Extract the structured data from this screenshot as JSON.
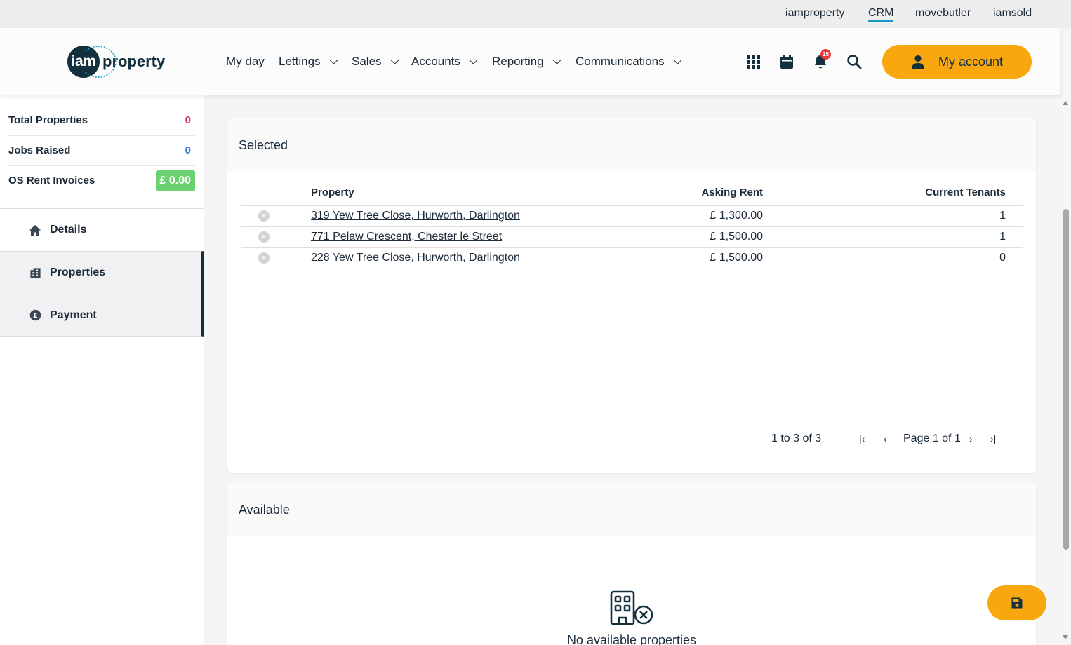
{
  "top_links": [
    "iamproperty",
    "CRM",
    "movebutler",
    "iamsold"
  ],
  "logo": {
    "circle_text": "iam",
    "text": "property"
  },
  "nav": {
    "items": [
      "My day",
      "Lettings",
      "Sales",
      "Accounts",
      "Reporting",
      "Communications"
    ]
  },
  "header_icons": {
    "apps": "grid-icon",
    "calendar": "calendar-icon",
    "notifications": "bell-icon",
    "notification_count": "25",
    "search": "search-icon"
  },
  "account_button": {
    "label": "My account",
    "icon": "user-icon"
  },
  "sidebar": {
    "stats": [
      {
        "label": "Total Properties",
        "value": "0",
        "color": "#d1356b"
      },
      {
        "label": "Jobs Raised",
        "value": "0",
        "color": "#2f6fd6"
      },
      {
        "label": "OS Rent Invoices",
        "value": "£ 0.00",
        "color": "#6ad171"
      }
    ],
    "menu": [
      {
        "label": "Details",
        "icon": "home-icon"
      },
      {
        "label": "Properties",
        "icon": "building-icon"
      },
      {
        "label": "Payment",
        "icon": "pound-coin-icon"
      }
    ]
  },
  "selected": {
    "title": "Selected",
    "columns": [
      "Property",
      "Asking Rent",
      "Current Tenants"
    ],
    "rows": [
      {
        "property": "319 Yew Tree Close, Hurworth, Darlington",
        "rent": "£ 1,300.00",
        "tenants": "1"
      },
      {
        "property": "771 Pelaw Crescent, Chester le Street",
        "rent": "£ 1,500.00",
        "tenants": "1"
      },
      {
        "property": "228 Yew Tree Close, Hurworth, Darlington",
        "rent": "£ 1,500.00",
        "tenants": "0"
      }
    ],
    "pager": {
      "summary": "1 to 3 of 3",
      "page_label": "Page 1 of 1"
    }
  },
  "available": {
    "title": "Available",
    "empty_text": "No available properties",
    "empty_icon": "building-x-icon"
  },
  "fab": {
    "icon": "save-icon"
  },
  "colors": {
    "accent": "#f9a70f",
    "navy": "#13303f",
    "link_underline": "#1b98c9"
  }
}
